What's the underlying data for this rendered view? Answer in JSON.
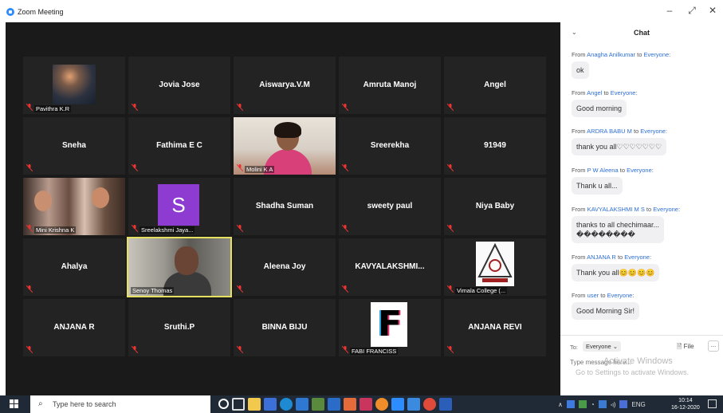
{
  "window": {
    "title": "Zoom Meeting",
    "minimize": "–",
    "restore": "⤢",
    "close": "✕"
  },
  "tiles": [
    {
      "name": "",
      "label": "Pavithra K.R",
      "video": "night-photo"
    },
    {
      "name": "Jovia Jose",
      "label": ""
    },
    {
      "name": "Aiswarya.V.M",
      "label": ""
    },
    {
      "name": "Amruta Manoj",
      "label": ""
    },
    {
      "name": "Angel",
      "label": ""
    },
    {
      "name": "Sneha",
      "label": ""
    },
    {
      "name": "Fathima E C",
      "label": ""
    },
    {
      "name": "",
      "label": "Molini K A",
      "video": "teacher"
    },
    {
      "name": "Sreerekha",
      "label": ""
    },
    {
      "name": "91949",
      "label": ""
    },
    {
      "name": "",
      "label": "Mini Krishna K",
      "video": "women"
    },
    {
      "name": "",
      "label": "Sreelakshmi Jaya...",
      "avatar_letter": "S"
    },
    {
      "name": "Shadha Suman",
      "label": ""
    },
    {
      "name": "sweety paul",
      "label": ""
    },
    {
      "name": "Niya Baby",
      "label": ""
    },
    {
      "name": "Ahalya",
      "label": ""
    },
    {
      "name": "",
      "label": "Senoy Thomas",
      "video": "man",
      "active_speaker": true
    },
    {
      "name": "Aleena Joy",
      "label": ""
    },
    {
      "name": "KAVYALAKSHMI...",
      "label": ""
    },
    {
      "name": "",
      "label": "Vimala College (...",
      "video": "college-logo"
    },
    {
      "name": "ANJANA R",
      "label": ""
    },
    {
      "name": "Sruthi.P",
      "label": ""
    },
    {
      "name": "BINNA BIJU",
      "label": ""
    },
    {
      "name": "",
      "label": "FABI FRANCISS",
      "video": "f-logo"
    },
    {
      "name": "ANJANA REVI",
      "label": ""
    }
  ],
  "chat": {
    "title": "Chat",
    "collapse_icon": "⌄",
    "messages": [
      {
        "from_prefix": "From ",
        "sender": "Anagha Anilkumar",
        "to": " to ",
        "target": "Everyone",
        "suffix": ":",
        "text": "ok"
      },
      {
        "from_prefix": "From ",
        "sender": "Angel",
        "to": " to ",
        "target": "Everyone",
        "suffix": ":",
        "text": "Good morning"
      },
      {
        "from_prefix": "From ",
        "sender": "ARDRA BABU M",
        "to": " to ",
        "target": "Everyone",
        "suffix": ":",
        "text": "thank you all♡♡♡♡♡♡♡"
      },
      {
        "from_prefix": "From ",
        "sender": "P W Aleena",
        "to": " to ",
        "target": "Everyone",
        "suffix": ":",
        "text": "Thank u all..."
      },
      {
        "from_prefix": "From ",
        "sender": "KAVYALAKSHMI M S",
        "to": " to ",
        "target": "Everyone",
        "suffix": ":",
        "text": "thanks to all chechimaar...",
        "text2": "��������"
      },
      {
        "from_prefix": "From ",
        "sender": "ANJANA R",
        "to": " to ",
        "target": "Everyone",
        "suffix": ":",
        "text": "Thank you all😊😊😊😊"
      },
      {
        "from_prefix": "From ",
        "sender": "user",
        "to": " to ",
        "target": "Everyone",
        "suffix": ":",
        "text": "Good Morning Sir!"
      }
    ],
    "to_label": "To:",
    "to_value": "Everyone ⌄",
    "file_label": "🗎 File",
    "more_label": "...",
    "input_placeholder": "Type message here...",
    "watermark_line1": "Activate Windows",
    "watermark_line2": "Go to Settings to activate Windows."
  },
  "taskbar": {
    "search_placeholder": "Type here to search",
    "search_icon": "⌕",
    "tray_language": "ENG",
    "tray_expand": "∧",
    "clock_time": "10:14",
    "clock_date": "16-12-2020"
  },
  "colors": {
    "meeting_bg": "#1a1a1a",
    "tile_bg": "#232323",
    "active_speaker_border": "#e6e060",
    "link_blue": "#2d6fd4",
    "taskbar_bg": "#1f2a36"
  }
}
